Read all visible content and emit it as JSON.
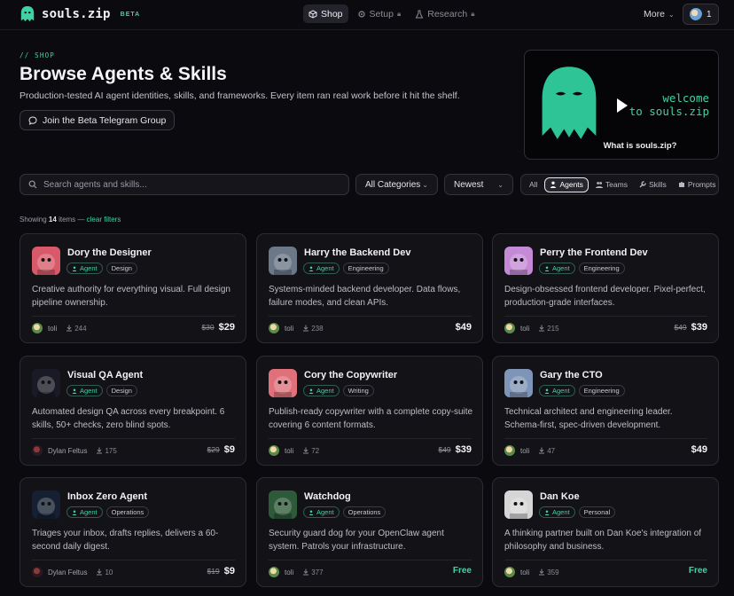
{
  "nav": {
    "brand": "souls.zip",
    "beta": "BETA",
    "tabs": [
      {
        "label": "Shop",
        "active": true,
        "locked": false
      },
      {
        "label": "Setup",
        "active": false,
        "locked": true
      },
      {
        "label": "Research",
        "active": false,
        "locked": true
      }
    ],
    "more": "More",
    "user_count": "1"
  },
  "hero": {
    "eyebrow": "// SHOP",
    "title": "Browse Agents & Skills",
    "subtitle": "Production-tested AI agent identities, skills, and frameworks. Every item ran real work before it hit the shelf.",
    "telegram_button": "Join the Beta Telegram Group",
    "video": {
      "welcome_line1": "welcome",
      "welcome_line2": "to souls.zip",
      "caption": "What is souls.zip?"
    }
  },
  "filters": {
    "search_placeholder": "Search agents and skills...",
    "category": "All Categories",
    "sort": "Newest",
    "types": [
      {
        "label": "All",
        "active": false
      },
      {
        "label": "Agents",
        "active": true
      },
      {
        "label": "Teams",
        "active": false
      },
      {
        "label": "Skills",
        "active": false
      },
      {
        "label": "Prompts",
        "active": false
      }
    ]
  },
  "results": {
    "prefix": "Showing",
    "count": "14",
    "suffix": "items —",
    "clear": "clear filters"
  },
  "cards": [
    {
      "name": "Dory the Designer",
      "type": "Agent",
      "category": "Design",
      "desc": "Creative authority for everything visual. Full design pipeline ownership.",
      "author": "toli",
      "downloads": "244",
      "old_price": "$30",
      "price": "$29",
      "thumb": "#d85a6a"
    },
    {
      "name": "Harry the Backend Dev",
      "type": "Agent",
      "category": "Engineering",
      "desc": "Systems-minded backend developer. Data flows, failure modes, and clean APIs.",
      "author": "toli",
      "downloads": "238",
      "old_price": "",
      "price": "$49",
      "thumb": "#6b7888"
    },
    {
      "name": "Perry the Frontend Dev",
      "type": "Agent",
      "category": "Engineering",
      "desc": "Design-obsessed frontend developer. Pixel-perfect, production-grade interfaces.",
      "author": "toli",
      "downloads": "215",
      "old_price": "$49",
      "price": "$39",
      "thumb": "#c58ad6"
    },
    {
      "name": "Visual QA Agent",
      "type": "Agent",
      "category": "Design",
      "desc": "Automated design QA across every breakpoint. 6 skills, 50+ checks, zero blind spots.",
      "author": "Dylan Feltus",
      "downloads": "175",
      "old_price": "$29",
      "price": "$9",
      "thumb": "#1a1a26"
    },
    {
      "name": "Cory the Copywriter",
      "type": "Agent",
      "category": "Writing",
      "desc": "Publish-ready copywriter with a complete copy-suite covering 6 content formats.",
      "author": "toli",
      "downloads": "72",
      "old_price": "$49",
      "price": "$39",
      "thumb": "#e0707a"
    },
    {
      "name": "Gary the CTO",
      "type": "Agent",
      "category": "Engineering",
      "desc": "Technical architect and engineering leader. Schema-first, spec-driven development.",
      "author": "toli",
      "downloads": "47",
      "old_price": "",
      "price": "$49",
      "thumb": "#7f95b8"
    },
    {
      "name": "Inbox Zero Agent",
      "type": "Agent",
      "category": "Operations",
      "desc": "Triages your inbox, drafts replies, delivers a 60-second daily digest.",
      "author": "Dylan Feltus",
      "downloads": "10",
      "old_price": "$19",
      "price": "$9",
      "thumb": "#162032"
    },
    {
      "name": "Watchdog",
      "type": "Agent",
      "category": "Operations",
      "desc": "Security guard dog for your OpenClaw agent system. Patrols your infrastructure.",
      "author": "toli",
      "downloads": "377",
      "old_price": "",
      "price": "Free",
      "thumb": "#2e5a3a"
    },
    {
      "name": "Dan Koe",
      "type": "Agent",
      "category": "Personal",
      "desc": "A thinking partner built on Dan Koe's integration of philosophy and business.",
      "author": "toli",
      "downloads": "359",
      "old_price": "",
      "price": "Free",
      "thumb": "#d6d6d6"
    }
  ]
}
